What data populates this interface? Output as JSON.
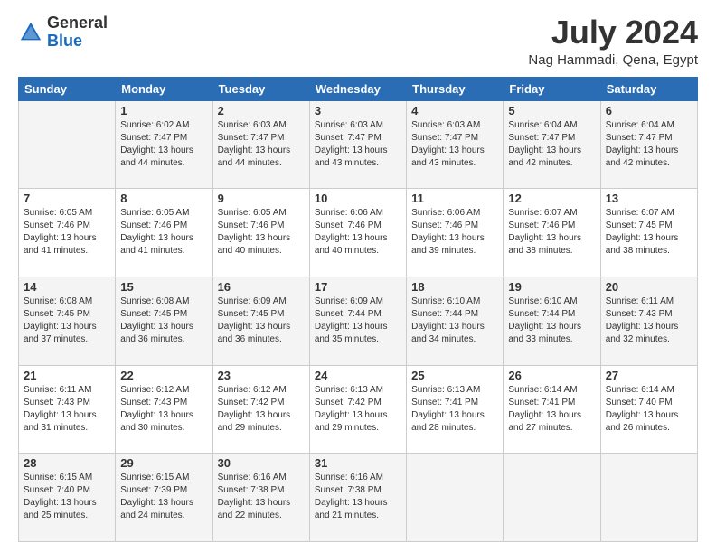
{
  "header": {
    "logo_line1": "General",
    "logo_line2": "Blue",
    "month": "July 2024",
    "location": "Nag Hammadi, Qena, Egypt"
  },
  "days_of_week": [
    "Sunday",
    "Monday",
    "Tuesday",
    "Wednesday",
    "Thursday",
    "Friday",
    "Saturday"
  ],
  "weeks": [
    [
      {
        "day": "",
        "info": ""
      },
      {
        "day": "1",
        "info": "Sunrise: 6:02 AM\nSunset: 7:47 PM\nDaylight: 13 hours\nand 44 minutes."
      },
      {
        "day": "2",
        "info": "Sunrise: 6:03 AM\nSunset: 7:47 PM\nDaylight: 13 hours\nand 44 minutes."
      },
      {
        "day": "3",
        "info": "Sunrise: 6:03 AM\nSunset: 7:47 PM\nDaylight: 13 hours\nand 43 minutes."
      },
      {
        "day": "4",
        "info": "Sunrise: 6:03 AM\nSunset: 7:47 PM\nDaylight: 13 hours\nand 43 minutes."
      },
      {
        "day": "5",
        "info": "Sunrise: 6:04 AM\nSunset: 7:47 PM\nDaylight: 13 hours\nand 42 minutes."
      },
      {
        "day": "6",
        "info": "Sunrise: 6:04 AM\nSunset: 7:47 PM\nDaylight: 13 hours\nand 42 minutes."
      }
    ],
    [
      {
        "day": "7",
        "info": "Sunrise: 6:05 AM\nSunset: 7:46 PM\nDaylight: 13 hours\nand 41 minutes."
      },
      {
        "day": "8",
        "info": "Sunrise: 6:05 AM\nSunset: 7:46 PM\nDaylight: 13 hours\nand 41 minutes."
      },
      {
        "day": "9",
        "info": "Sunrise: 6:05 AM\nSunset: 7:46 PM\nDaylight: 13 hours\nand 40 minutes."
      },
      {
        "day": "10",
        "info": "Sunrise: 6:06 AM\nSunset: 7:46 PM\nDaylight: 13 hours\nand 40 minutes."
      },
      {
        "day": "11",
        "info": "Sunrise: 6:06 AM\nSunset: 7:46 PM\nDaylight: 13 hours\nand 39 minutes."
      },
      {
        "day": "12",
        "info": "Sunrise: 6:07 AM\nSunset: 7:46 PM\nDaylight: 13 hours\nand 38 minutes."
      },
      {
        "day": "13",
        "info": "Sunrise: 6:07 AM\nSunset: 7:45 PM\nDaylight: 13 hours\nand 38 minutes."
      }
    ],
    [
      {
        "day": "14",
        "info": "Sunrise: 6:08 AM\nSunset: 7:45 PM\nDaylight: 13 hours\nand 37 minutes."
      },
      {
        "day": "15",
        "info": "Sunrise: 6:08 AM\nSunset: 7:45 PM\nDaylight: 13 hours\nand 36 minutes."
      },
      {
        "day": "16",
        "info": "Sunrise: 6:09 AM\nSunset: 7:45 PM\nDaylight: 13 hours\nand 36 minutes."
      },
      {
        "day": "17",
        "info": "Sunrise: 6:09 AM\nSunset: 7:44 PM\nDaylight: 13 hours\nand 35 minutes."
      },
      {
        "day": "18",
        "info": "Sunrise: 6:10 AM\nSunset: 7:44 PM\nDaylight: 13 hours\nand 34 minutes."
      },
      {
        "day": "19",
        "info": "Sunrise: 6:10 AM\nSunset: 7:44 PM\nDaylight: 13 hours\nand 33 minutes."
      },
      {
        "day": "20",
        "info": "Sunrise: 6:11 AM\nSunset: 7:43 PM\nDaylight: 13 hours\nand 32 minutes."
      }
    ],
    [
      {
        "day": "21",
        "info": "Sunrise: 6:11 AM\nSunset: 7:43 PM\nDaylight: 13 hours\nand 31 minutes."
      },
      {
        "day": "22",
        "info": "Sunrise: 6:12 AM\nSunset: 7:43 PM\nDaylight: 13 hours\nand 30 minutes."
      },
      {
        "day": "23",
        "info": "Sunrise: 6:12 AM\nSunset: 7:42 PM\nDaylight: 13 hours\nand 29 minutes."
      },
      {
        "day": "24",
        "info": "Sunrise: 6:13 AM\nSunset: 7:42 PM\nDaylight: 13 hours\nand 29 minutes."
      },
      {
        "day": "25",
        "info": "Sunrise: 6:13 AM\nSunset: 7:41 PM\nDaylight: 13 hours\nand 28 minutes."
      },
      {
        "day": "26",
        "info": "Sunrise: 6:14 AM\nSunset: 7:41 PM\nDaylight: 13 hours\nand 27 minutes."
      },
      {
        "day": "27",
        "info": "Sunrise: 6:14 AM\nSunset: 7:40 PM\nDaylight: 13 hours\nand 26 minutes."
      }
    ],
    [
      {
        "day": "28",
        "info": "Sunrise: 6:15 AM\nSunset: 7:40 PM\nDaylight: 13 hours\nand 25 minutes."
      },
      {
        "day": "29",
        "info": "Sunrise: 6:15 AM\nSunset: 7:39 PM\nDaylight: 13 hours\nand 24 minutes."
      },
      {
        "day": "30",
        "info": "Sunrise: 6:16 AM\nSunset: 7:38 PM\nDaylight: 13 hours\nand 22 minutes."
      },
      {
        "day": "31",
        "info": "Sunrise: 6:16 AM\nSunset: 7:38 PM\nDaylight: 13 hours\nand 21 minutes."
      },
      {
        "day": "",
        "info": ""
      },
      {
        "day": "",
        "info": ""
      },
      {
        "day": "",
        "info": ""
      }
    ]
  ]
}
